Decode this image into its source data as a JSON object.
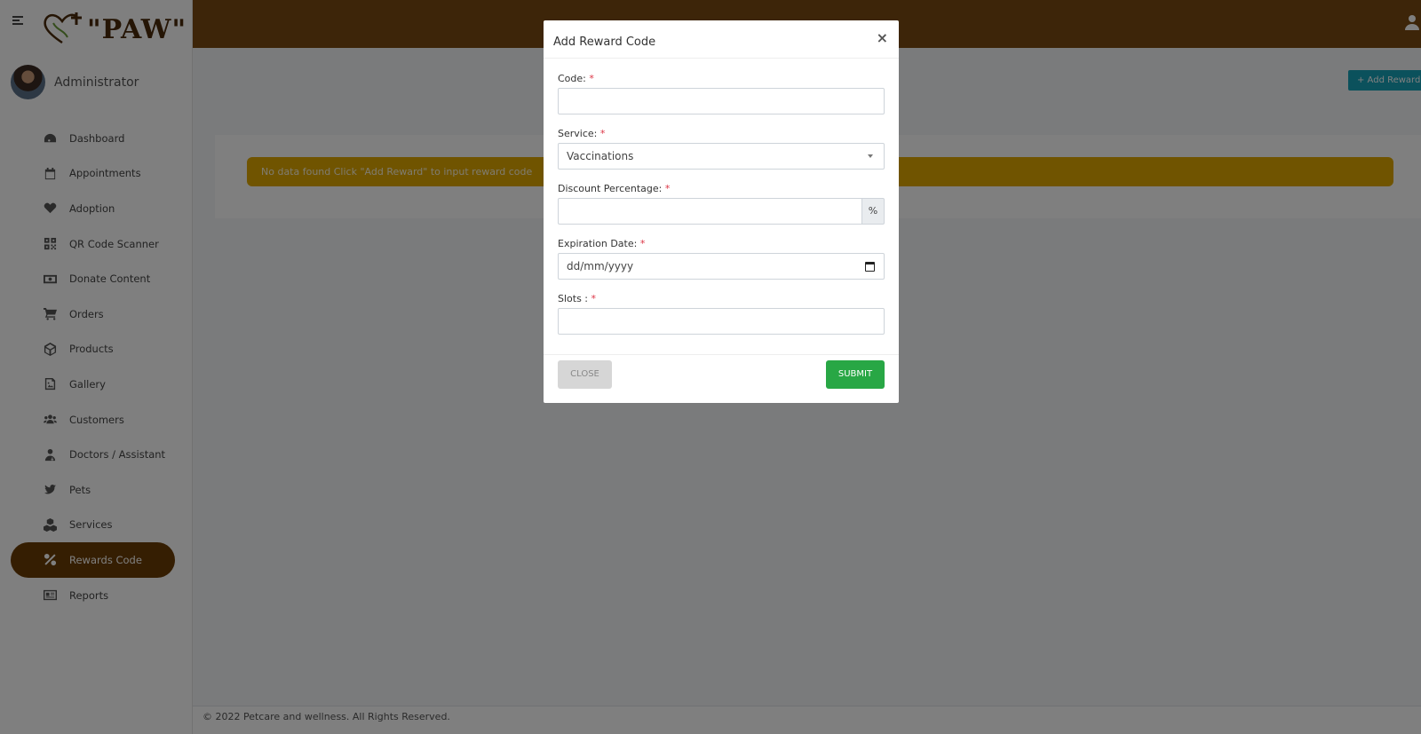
{
  "brand": {
    "logo_text": "\"PAW\""
  },
  "profile": {
    "name": "Administrator"
  },
  "sidebar": {
    "items": [
      {
        "label": "Dashboard",
        "icon": "dashboard-icon"
      },
      {
        "label": "Appointments",
        "icon": "calendar-icon"
      },
      {
        "label": "Adoption",
        "icon": "heart-icon"
      },
      {
        "label": "QR Code Scanner",
        "icon": "qrcode-icon"
      },
      {
        "label": "Donate Content",
        "icon": "money-icon"
      },
      {
        "label": "Orders",
        "icon": "cart-icon"
      },
      {
        "label": "Products",
        "icon": "cube-icon"
      },
      {
        "label": "Gallery",
        "icon": "image-icon"
      },
      {
        "label": "Customers",
        "icon": "users-icon"
      },
      {
        "label": "Doctors / Assistant",
        "icon": "doctor-icon"
      },
      {
        "label": "Pets",
        "icon": "bird-icon"
      },
      {
        "label": "Services",
        "icon": "cubes-icon"
      },
      {
        "label": "Rewards Code",
        "icon": "percent-icon",
        "active": true
      },
      {
        "label": "Reports",
        "icon": "newspaper-icon"
      }
    ]
  },
  "main": {
    "add_button_label": "+ Add Reward",
    "alert_text": "No data found Click \"Add Reward\" to input reward code"
  },
  "footer": {
    "text": "© 2022 Petcare and wellness. All Rights Reserved."
  },
  "modal": {
    "title": "Add Reward Code",
    "close_symbol": "×",
    "required_mark": "*",
    "fields": {
      "code_label": "Code:",
      "code_value": "",
      "service_label": "Service:",
      "service_value": "Vaccinations",
      "discount_label": "Discount Percentage:",
      "discount_value": "",
      "discount_addon": "%",
      "expiration_label": "Expiration Date:",
      "expiration_placeholder": "dd/mm/yyyy",
      "slots_label": "Slots :",
      "slots_value": ""
    },
    "close_button": "CLOSE",
    "submit_button": "SUBMIT"
  },
  "colors": {
    "header": "#7a4a12",
    "active_nav": "#6b3d05",
    "alert": "#e0a800",
    "submit": "#28a745",
    "add_button": "#17a2b8"
  }
}
